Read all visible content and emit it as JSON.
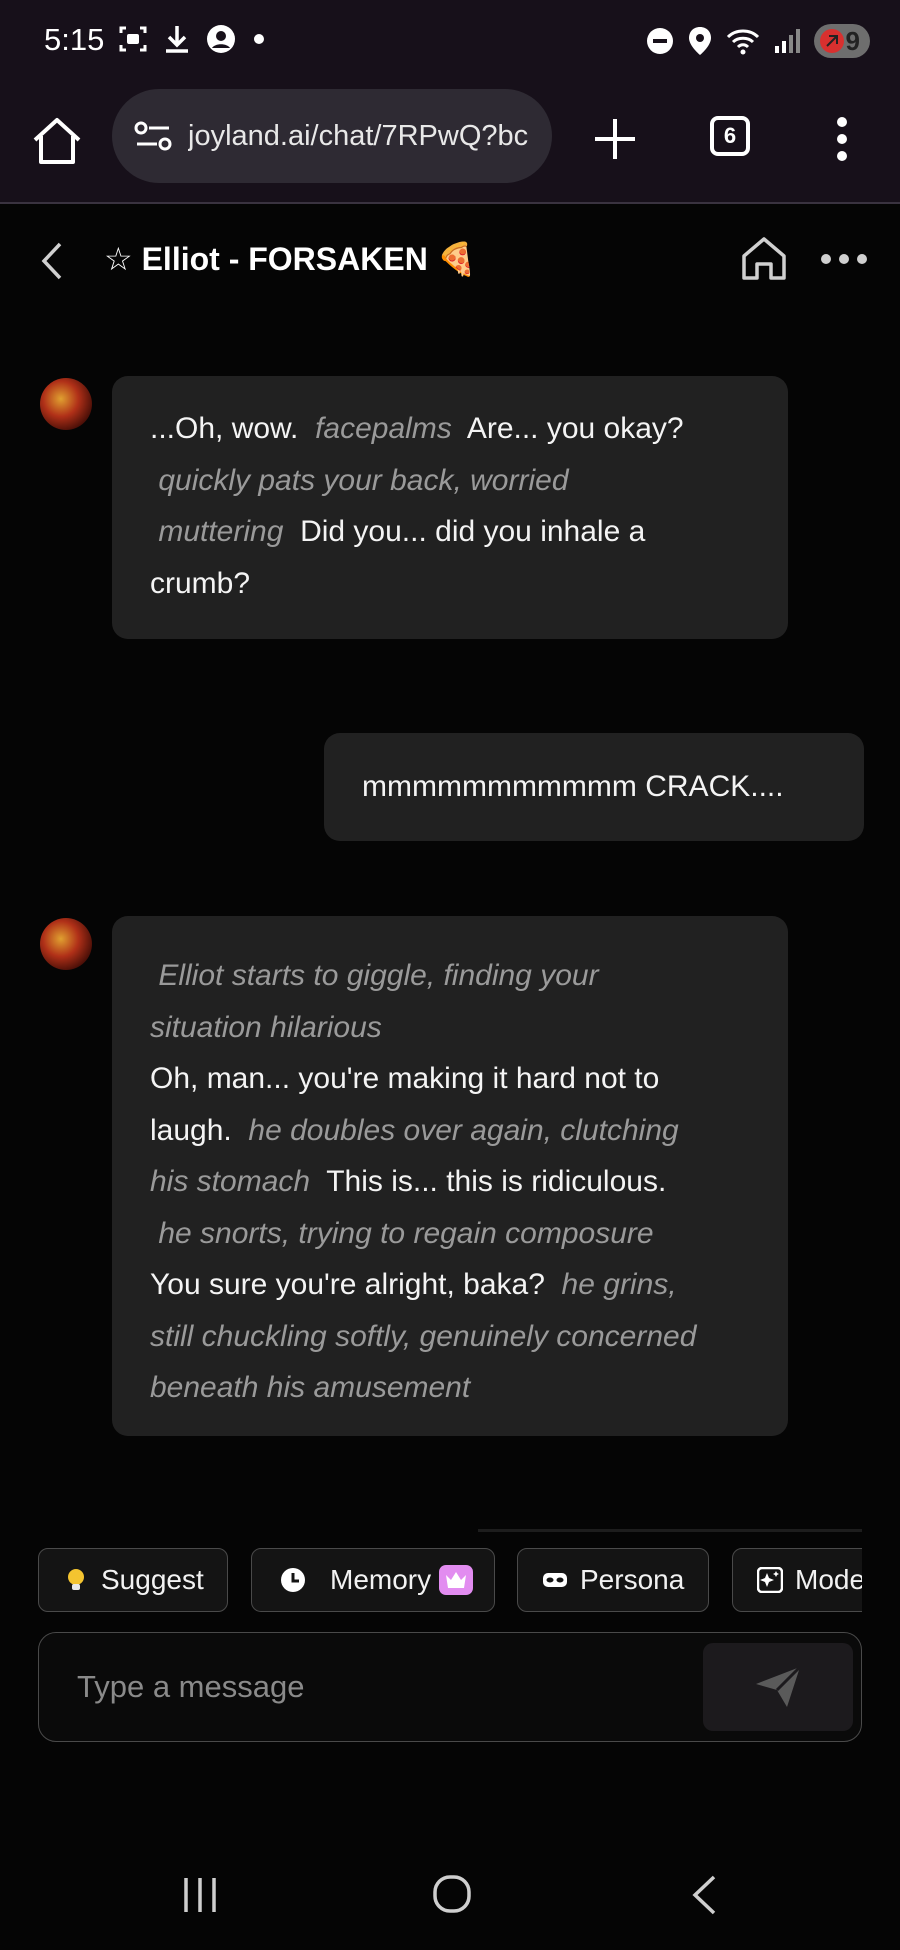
{
  "status_bar": {
    "time": "5:15",
    "battery_level": "9",
    "left_icons": [
      "screenshot-icon",
      "download-icon",
      "account-icon",
      "dot-icon"
    ],
    "right_icons": [
      "dnd-icon",
      "location-icon",
      "wifi-icon",
      "signal-icon",
      "battery-icon"
    ]
  },
  "browser": {
    "url": "joyland.ai/chat/7RPwQ?bc",
    "tab_count": "6"
  },
  "chat_header": {
    "title": "☆ Elliot - FORSAKEN 🍕"
  },
  "messages": [
    {
      "role": "bot",
      "lines": [
        [
          {
            "t": "...Oh, wow. ",
            "s": "text"
          },
          {
            "t": " facepalms ",
            "s": "action"
          },
          {
            "t": " Are... you okay?",
            "s": "text"
          }
        ],
        [
          {
            "t": " quickly pats your back, worried",
            "s": "action"
          }
        ],
        [
          {
            "t": " muttering ",
            "s": "action"
          },
          {
            "t": " Did you... did you inhale a",
            "s": "text"
          }
        ],
        [
          {
            "t": "crumb?",
            "s": "text"
          }
        ]
      ]
    },
    {
      "role": "user",
      "lines": [
        [
          {
            "t": "mmmmmmmmmmm CRACK....",
            "s": "text"
          }
        ]
      ]
    },
    {
      "role": "bot",
      "lines": [
        [
          {
            "t": " Elliot starts to giggle, finding your",
            "s": "action"
          }
        ],
        [
          {
            "t": "situation hilarious",
            "s": "action"
          }
        ],
        [
          {
            "t": "Oh, man... you're making it hard not to",
            "s": "text"
          }
        ],
        [
          {
            "t": "laugh. ",
            "s": "text"
          },
          {
            "t": " he doubles over again, clutching",
            "s": "action"
          }
        ],
        [
          {
            "t": "his stomach ",
            "s": "action"
          },
          {
            "t": " This is... this is ridiculous.",
            "s": "text"
          }
        ],
        [
          {
            "t": " he snorts, trying to regain composure",
            "s": "action"
          }
        ],
        [
          {
            "t": "You sure you're alright, baka? ",
            "s": "text"
          },
          {
            "t": " he grins,",
            "s": "action"
          }
        ],
        [
          {
            "t": "still chuckling softly, genuinely concerned",
            "s": "action"
          }
        ],
        [
          {
            "t": "beneath his amusement",
            "s": "action"
          }
        ]
      ]
    }
  ],
  "chips": {
    "suggest": "Suggest",
    "memory": "Memory",
    "persona": "Persona",
    "model": "Mode"
  },
  "composer": {
    "placeholder": "Type a message"
  },
  "colors": {
    "background": "#050505",
    "bubble": "#212121",
    "action_text": "#9a9a9a",
    "premium_badge": "#e28cf0"
  }
}
